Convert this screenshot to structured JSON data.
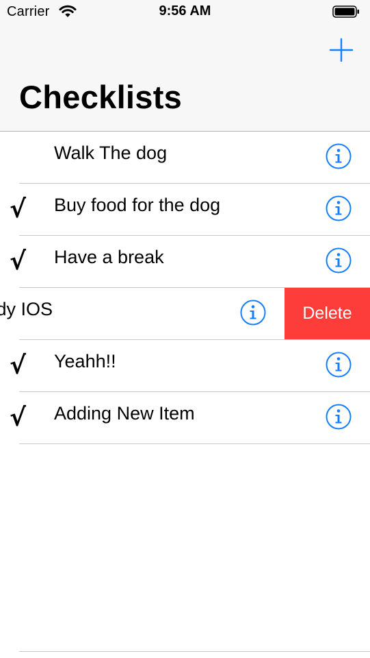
{
  "status_bar": {
    "carrier": "Carrier",
    "time": "9:56 AM",
    "wifi_icon": "wifi-icon",
    "battery_icon": "battery-icon"
  },
  "nav": {
    "title": "Checklists",
    "add_icon": "plus-icon"
  },
  "colors": {
    "tint": "#147efb",
    "delete": "#fc3d39",
    "nav_background": "#f7f7f7",
    "separator": "#c8c7cc"
  },
  "items": [
    {
      "text": "Walk The dog",
      "checkmark": "",
      "checked": false,
      "swiped": false
    },
    {
      "text": "Buy food for the dog",
      "checkmark": "√",
      "checked": true,
      "swiped": false
    },
    {
      "text": "Have a break",
      "checkmark": "√",
      "checked": true,
      "swiped": false
    },
    {
      "text": "Study IOS",
      "checkmark": "√",
      "checked": true,
      "swiped": true,
      "delete_label": "Delete"
    },
    {
      "text": "Yeahh!!",
      "checkmark": "√",
      "checked": true,
      "swiped": false
    },
    {
      "text": "Adding New Item",
      "checkmark": "√",
      "checked": true,
      "swiped": false
    }
  ]
}
